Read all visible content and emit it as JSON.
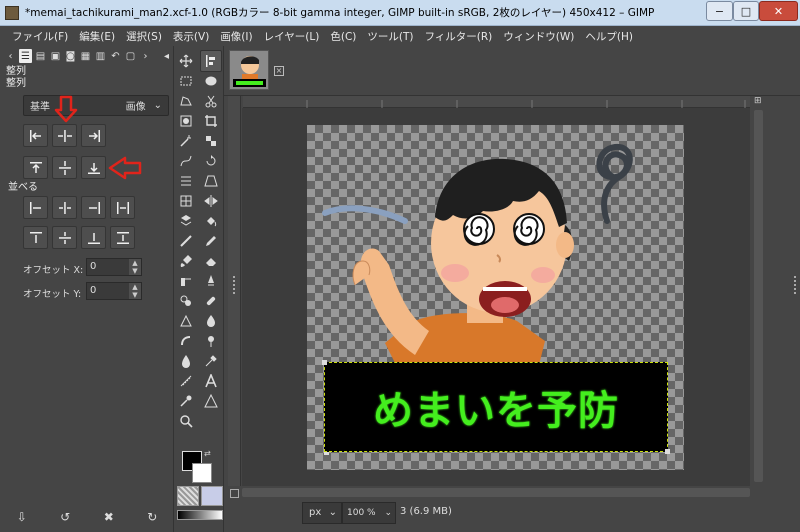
{
  "window": {
    "title": "*memai_tachikurami_man2.xcf-1.0 (RGBカラー 8-bit gamma integer, GIMP built-in sRGB, 2枚のレイヤー) 450x412 – GIMP",
    "minimize": "−",
    "maximize": "□",
    "close": "✕"
  },
  "menubar": {
    "items": [
      "ファイル(F)",
      "編集(E)",
      "選択(S)",
      "表示(V)",
      "画像(I)",
      "レイヤー(L)",
      "色(C)",
      "ツール(T)",
      "フィルター(R)",
      "ウィンドウ(W)",
      "ヘルプ(H)"
    ]
  },
  "align_dock": {
    "panel_title": "整列",
    "align_section": "整列",
    "relative_to_label": "基準",
    "relative_to_value": "画像",
    "distribute_section": "並べる",
    "offset_x_label": "オフセット X:",
    "offset_x_value": "0",
    "offset_y_label": "オフセット Y:",
    "offset_y_value": "0"
  },
  "canvas": {
    "caption_text": "めまいを予防"
  },
  "statusbar": {
    "unit": "px",
    "zoom": "100 %",
    "info": "3 (6.9 MB)"
  },
  "colors": {
    "caption_green": "#44ee1e",
    "annotation_red": "#e0241b"
  }
}
